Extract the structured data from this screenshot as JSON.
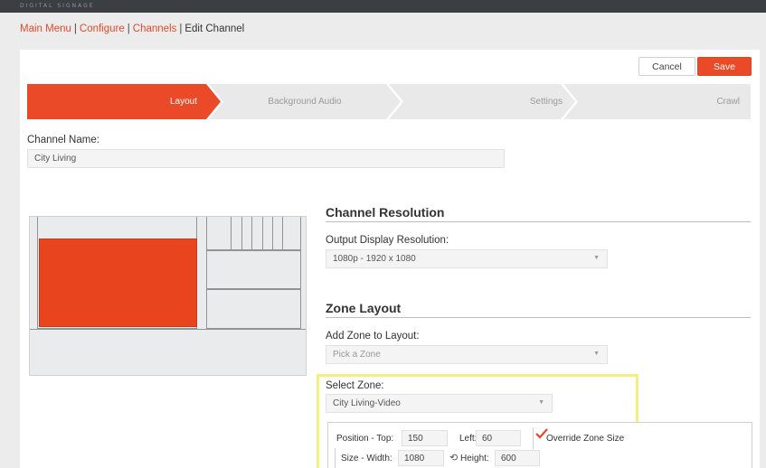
{
  "app": {
    "brand": "DIGITAL SIGNAGE"
  },
  "breadcrumb": {
    "main": "Main Menu",
    "configure": "Configure",
    "channels": "Channels",
    "current": "Edit Channel",
    "sep": "|"
  },
  "actions": {
    "cancel": "Cancel",
    "save": "Save"
  },
  "wizard": {
    "steps": [
      "Layout",
      "Background Audio",
      "Settings",
      "Crawl"
    ],
    "active_index": 0
  },
  "channel": {
    "name_label": "Channel Name:",
    "name_value": "City Living"
  },
  "resolution": {
    "section_title": "Channel Resolution",
    "label": "Output Display Resolution:",
    "value": "1080p - 1920 x 1080"
  },
  "zone_layout": {
    "section_title": "Zone Layout",
    "add_label": "Add Zone to Layout:",
    "add_placeholder": "Pick a Zone"
  },
  "select_zone": {
    "label": "Select Zone:",
    "value": "City Living-Video"
  },
  "zone_props": {
    "top_label": "Position - Top:",
    "top_value": "150",
    "left_label": "Left:",
    "left_value": "60",
    "override_label": "Override Zone Size",
    "override_checked": true,
    "width_label": "Size - Width:",
    "width_value": "1080",
    "height_label": "Height:",
    "height_value": "600"
  },
  "colors": {
    "accent": "#ea4a27",
    "highlight": "#f4f07a"
  }
}
